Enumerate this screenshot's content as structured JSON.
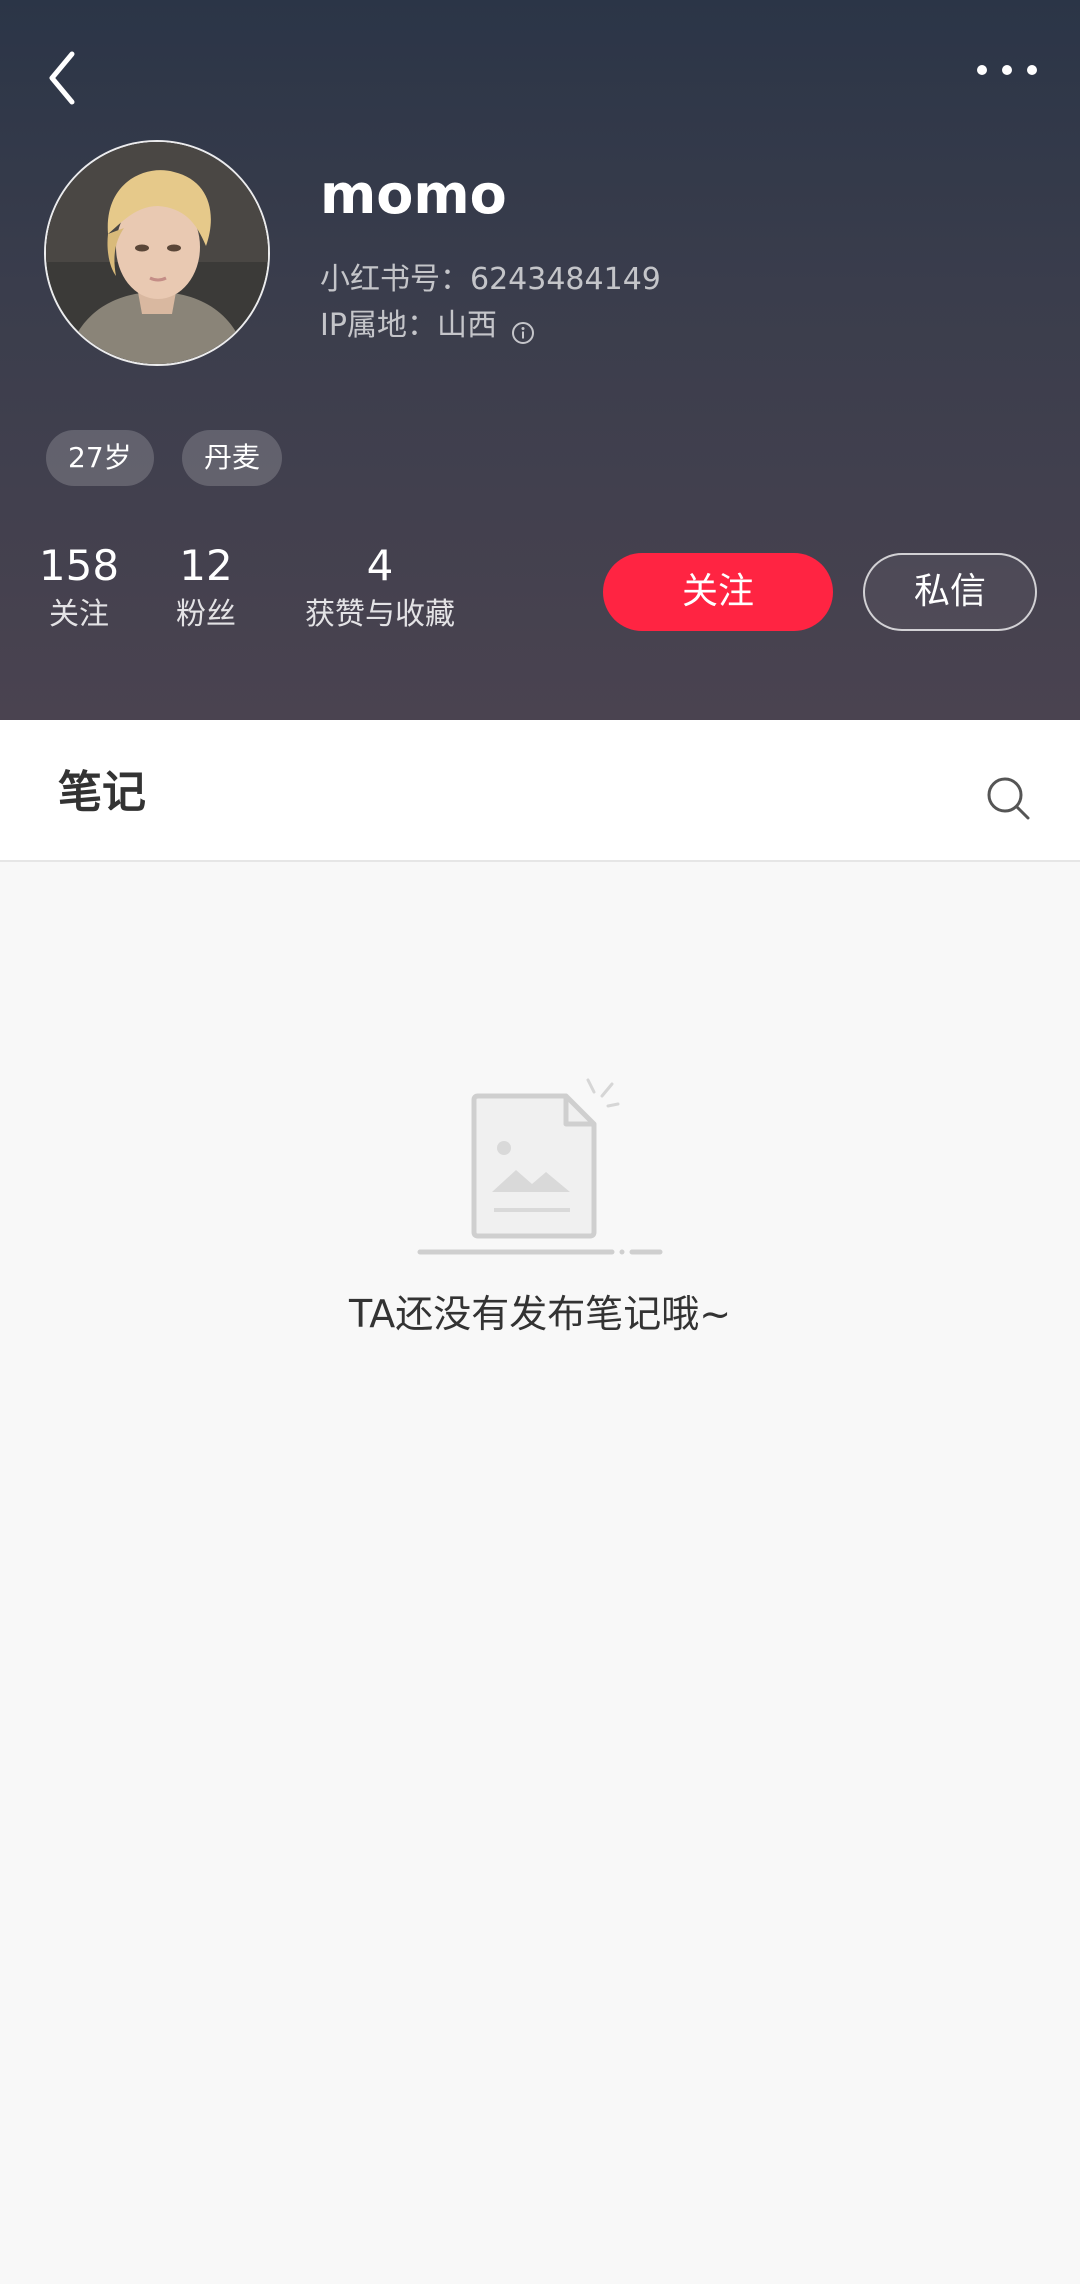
{
  "profile": {
    "nickname": "momo",
    "rednote_id": "小红书号：6243484149",
    "ip_location": "IP属地：山西",
    "tags": {
      "age": "27岁",
      "region": "丹麦"
    },
    "stats": {
      "following": {
        "count": "158",
        "label": "关注"
      },
      "fans": {
        "count": "12",
        "label": "粉丝"
      },
      "likes": {
        "count": "4",
        "label": "获赞与收藏"
      }
    },
    "actions": {
      "follow_label": "关注",
      "message_label": "私信"
    }
  },
  "notes": {
    "tab_label": "笔记",
    "empty_text": "TA还没有发布笔记哦~"
  },
  "colors": {
    "accent": "#ff2442",
    "header_top": "#2b3547",
    "header_bottom": "#4a4350"
  },
  "icons": {
    "back": "chevron-left-icon",
    "more": "more-horizontal-icon",
    "info": "info-icon",
    "search": "search-icon",
    "empty": "empty-document-icon"
  }
}
